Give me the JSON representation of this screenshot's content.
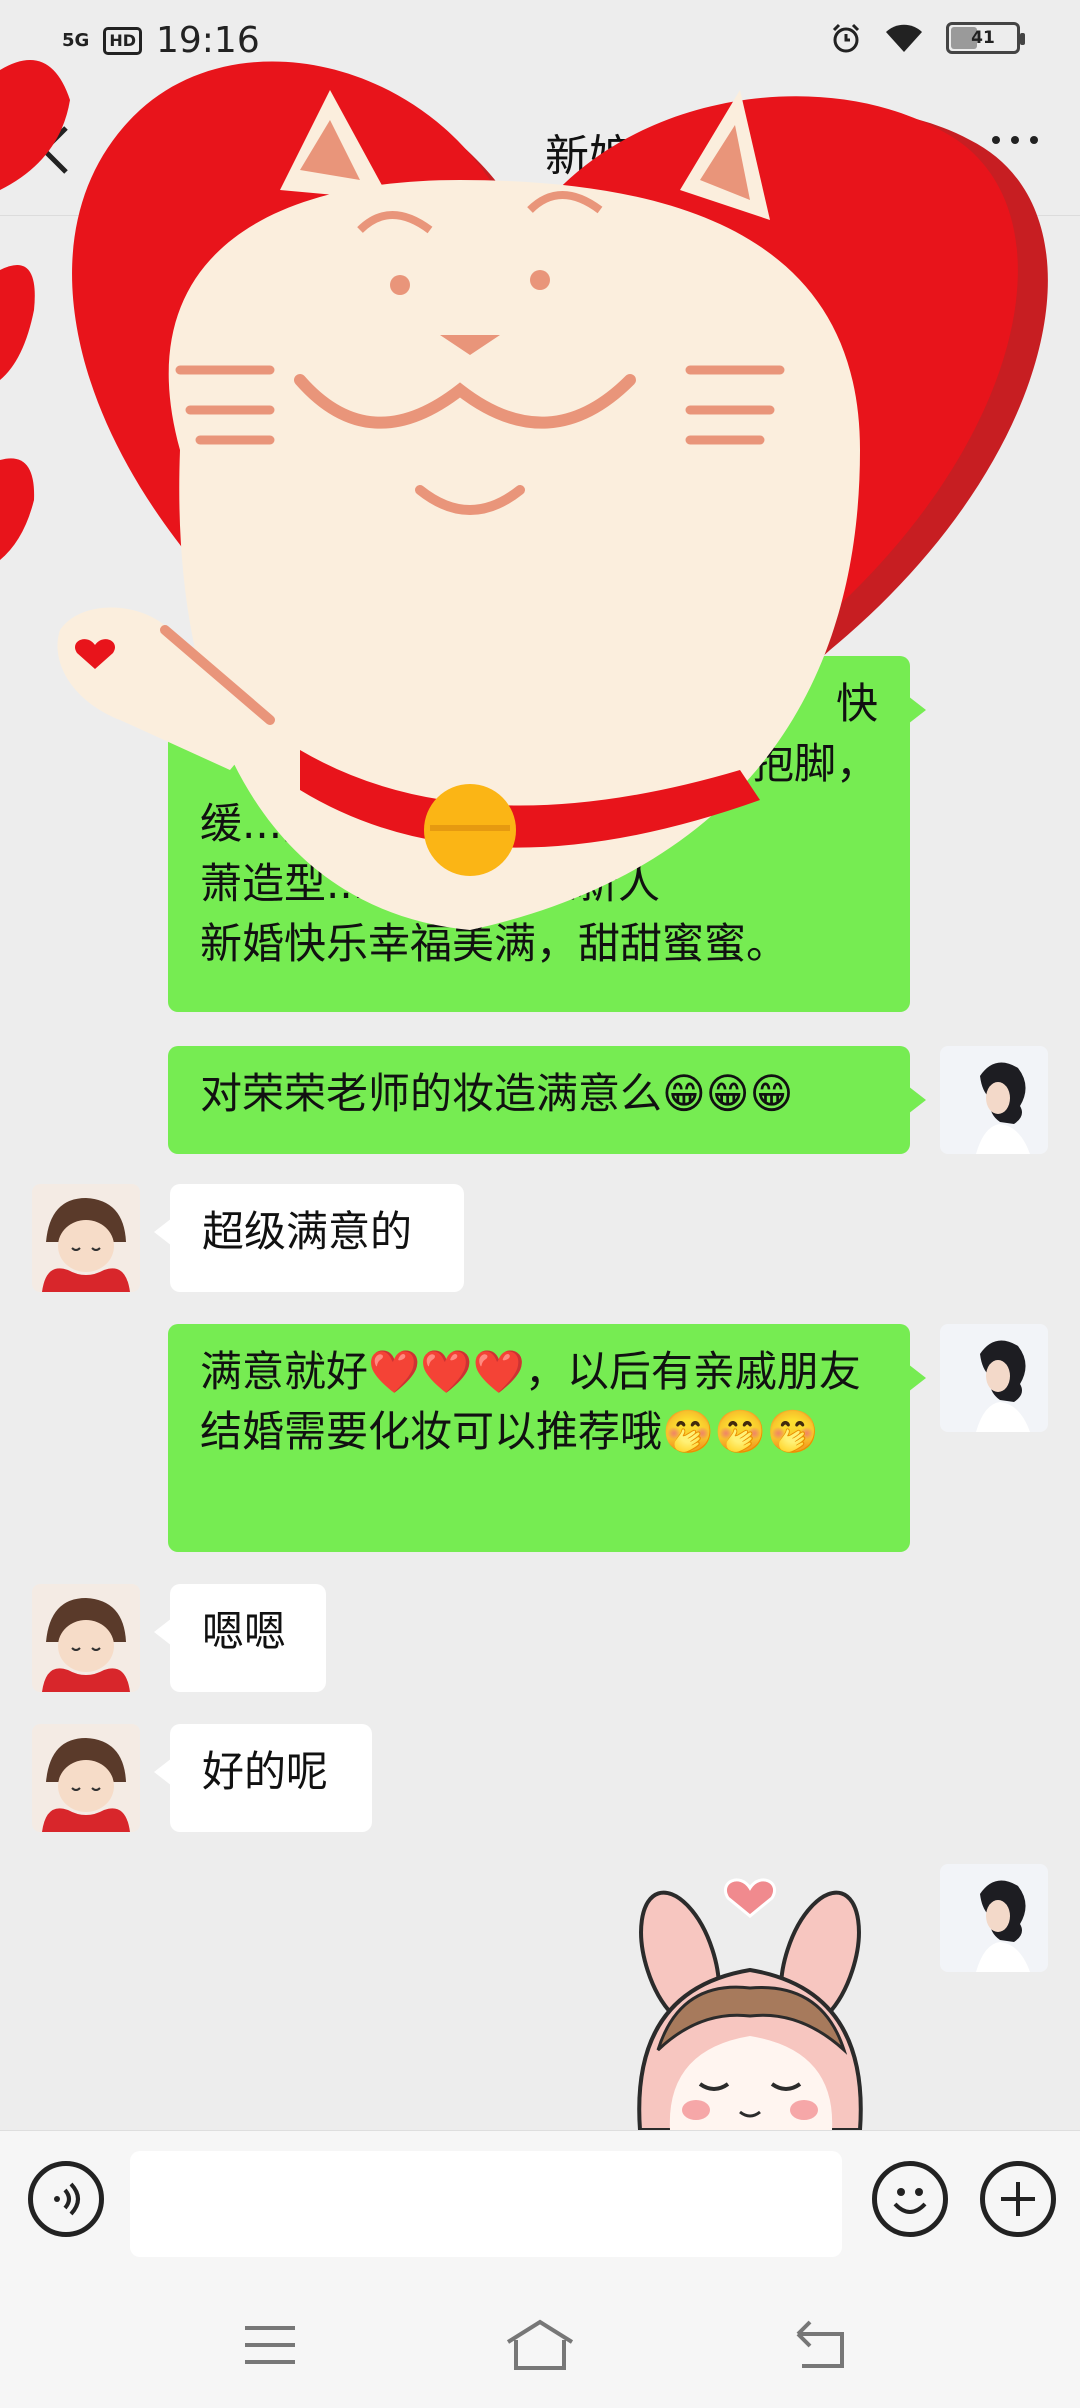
{
  "status_bar": {
    "network": "5G",
    "hd": "HD",
    "time": "19:16",
    "battery": "41"
  },
  "header": {
    "title": "新娘宝",
    "back_icon": "chevron-left-icon",
    "more_icon": "more-dots-icon"
  },
  "messages": [
    {
      "side": "right",
      "text": "缓...择我们萧萧造型...的祝福二位新人新婚快乐幸福美满，甜甜蜜蜜。",
      "lines": [
        "快",
        "...抱脚，",
        "缓...择我们萧",
        "萧造型...的祝福二位新人",
        "新婚快乐幸福美满，甜甜蜜蜜。"
      ]
    },
    {
      "side": "right",
      "text": "对荣荣老师的妆造满意么😁😁😁"
    },
    {
      "side": "left",
      "text": "超级满意的"
    },
    {
      "side": "right",
      "text": "满意就好❤️❤️❤️，以后有亲戚朋友结婚需要化妆可以推荐哦🤭🤭🤭"
    },
    {
      "side": "left",
      "text": "嗯嗯"
    },
    {
      "side": "left",
      "text": "好的呢"
    }
  ],
  "input_bar": {
    "voice_icon": "voice-icon",
    "emoji_icon": "emoji-icon",
    "plus_icon": "plus-icon",
    "placeholder": ""
  },
  "nav_bar": {
    "menu_icon": "menu-icon",
    "home_icon": "home-icon",
    "back_icon": "back-icon"
  },
  "colors": {
    "green_bubble": "#76ec52",
    "background": "#ededed",
    "heart_red": "#e8141b",
    "cat_cream": "#fbeedd"
  }
}
